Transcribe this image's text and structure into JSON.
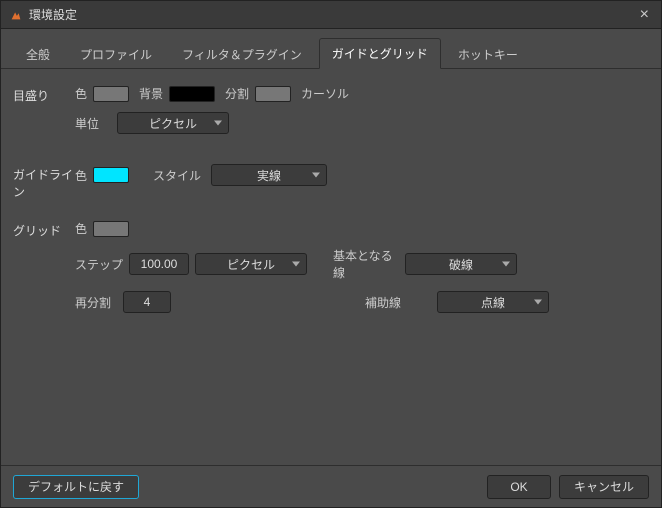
{
  "title": "環境設定",
  "tabs": [
    "全般",
    "プロファイル",
    "フィルタ＆プラグイン",
    "ガイドとグリッド",
    "ホットキー"
  ],
  "activeTab": 3,
  "labels": {
    "ruler": "目盛り",
    "color": "色",
    "background": "背景",
    "division": "分割",
    "cursor": "カーソル",
    "unit": "単位",
    "guideline": "ガイドライン",
    "style": "スタイル",
    "grid": "グリッド",
    "step": "ステップ",
    "baseLine": "基本となる線",
    "subdivision": "再分割",
    "subLine": "補助線"
  },
  "values": {
    "unit": "ピクセル",
    "style": "実線",
    "step": "100.00",
    "stepUnit": "ピクセル",
    "baseLine": "破線",
    "subdivision": "4",
    "subLine": "点線"
  },
  "colors": {
    "rulerColor": "#777777",
    "rulerBg": "#000000",
    "rulerDiv": "#777777",
    "rulerCursor": "#777777",
    "guideColor": "#00e5ff",
    "gridColor": "#777777"
  },
  "buttons": {
    "reset": "デフォルトに戻す",
    "ok": "OK",
    "cancel": "キャンセル"
  }
}
